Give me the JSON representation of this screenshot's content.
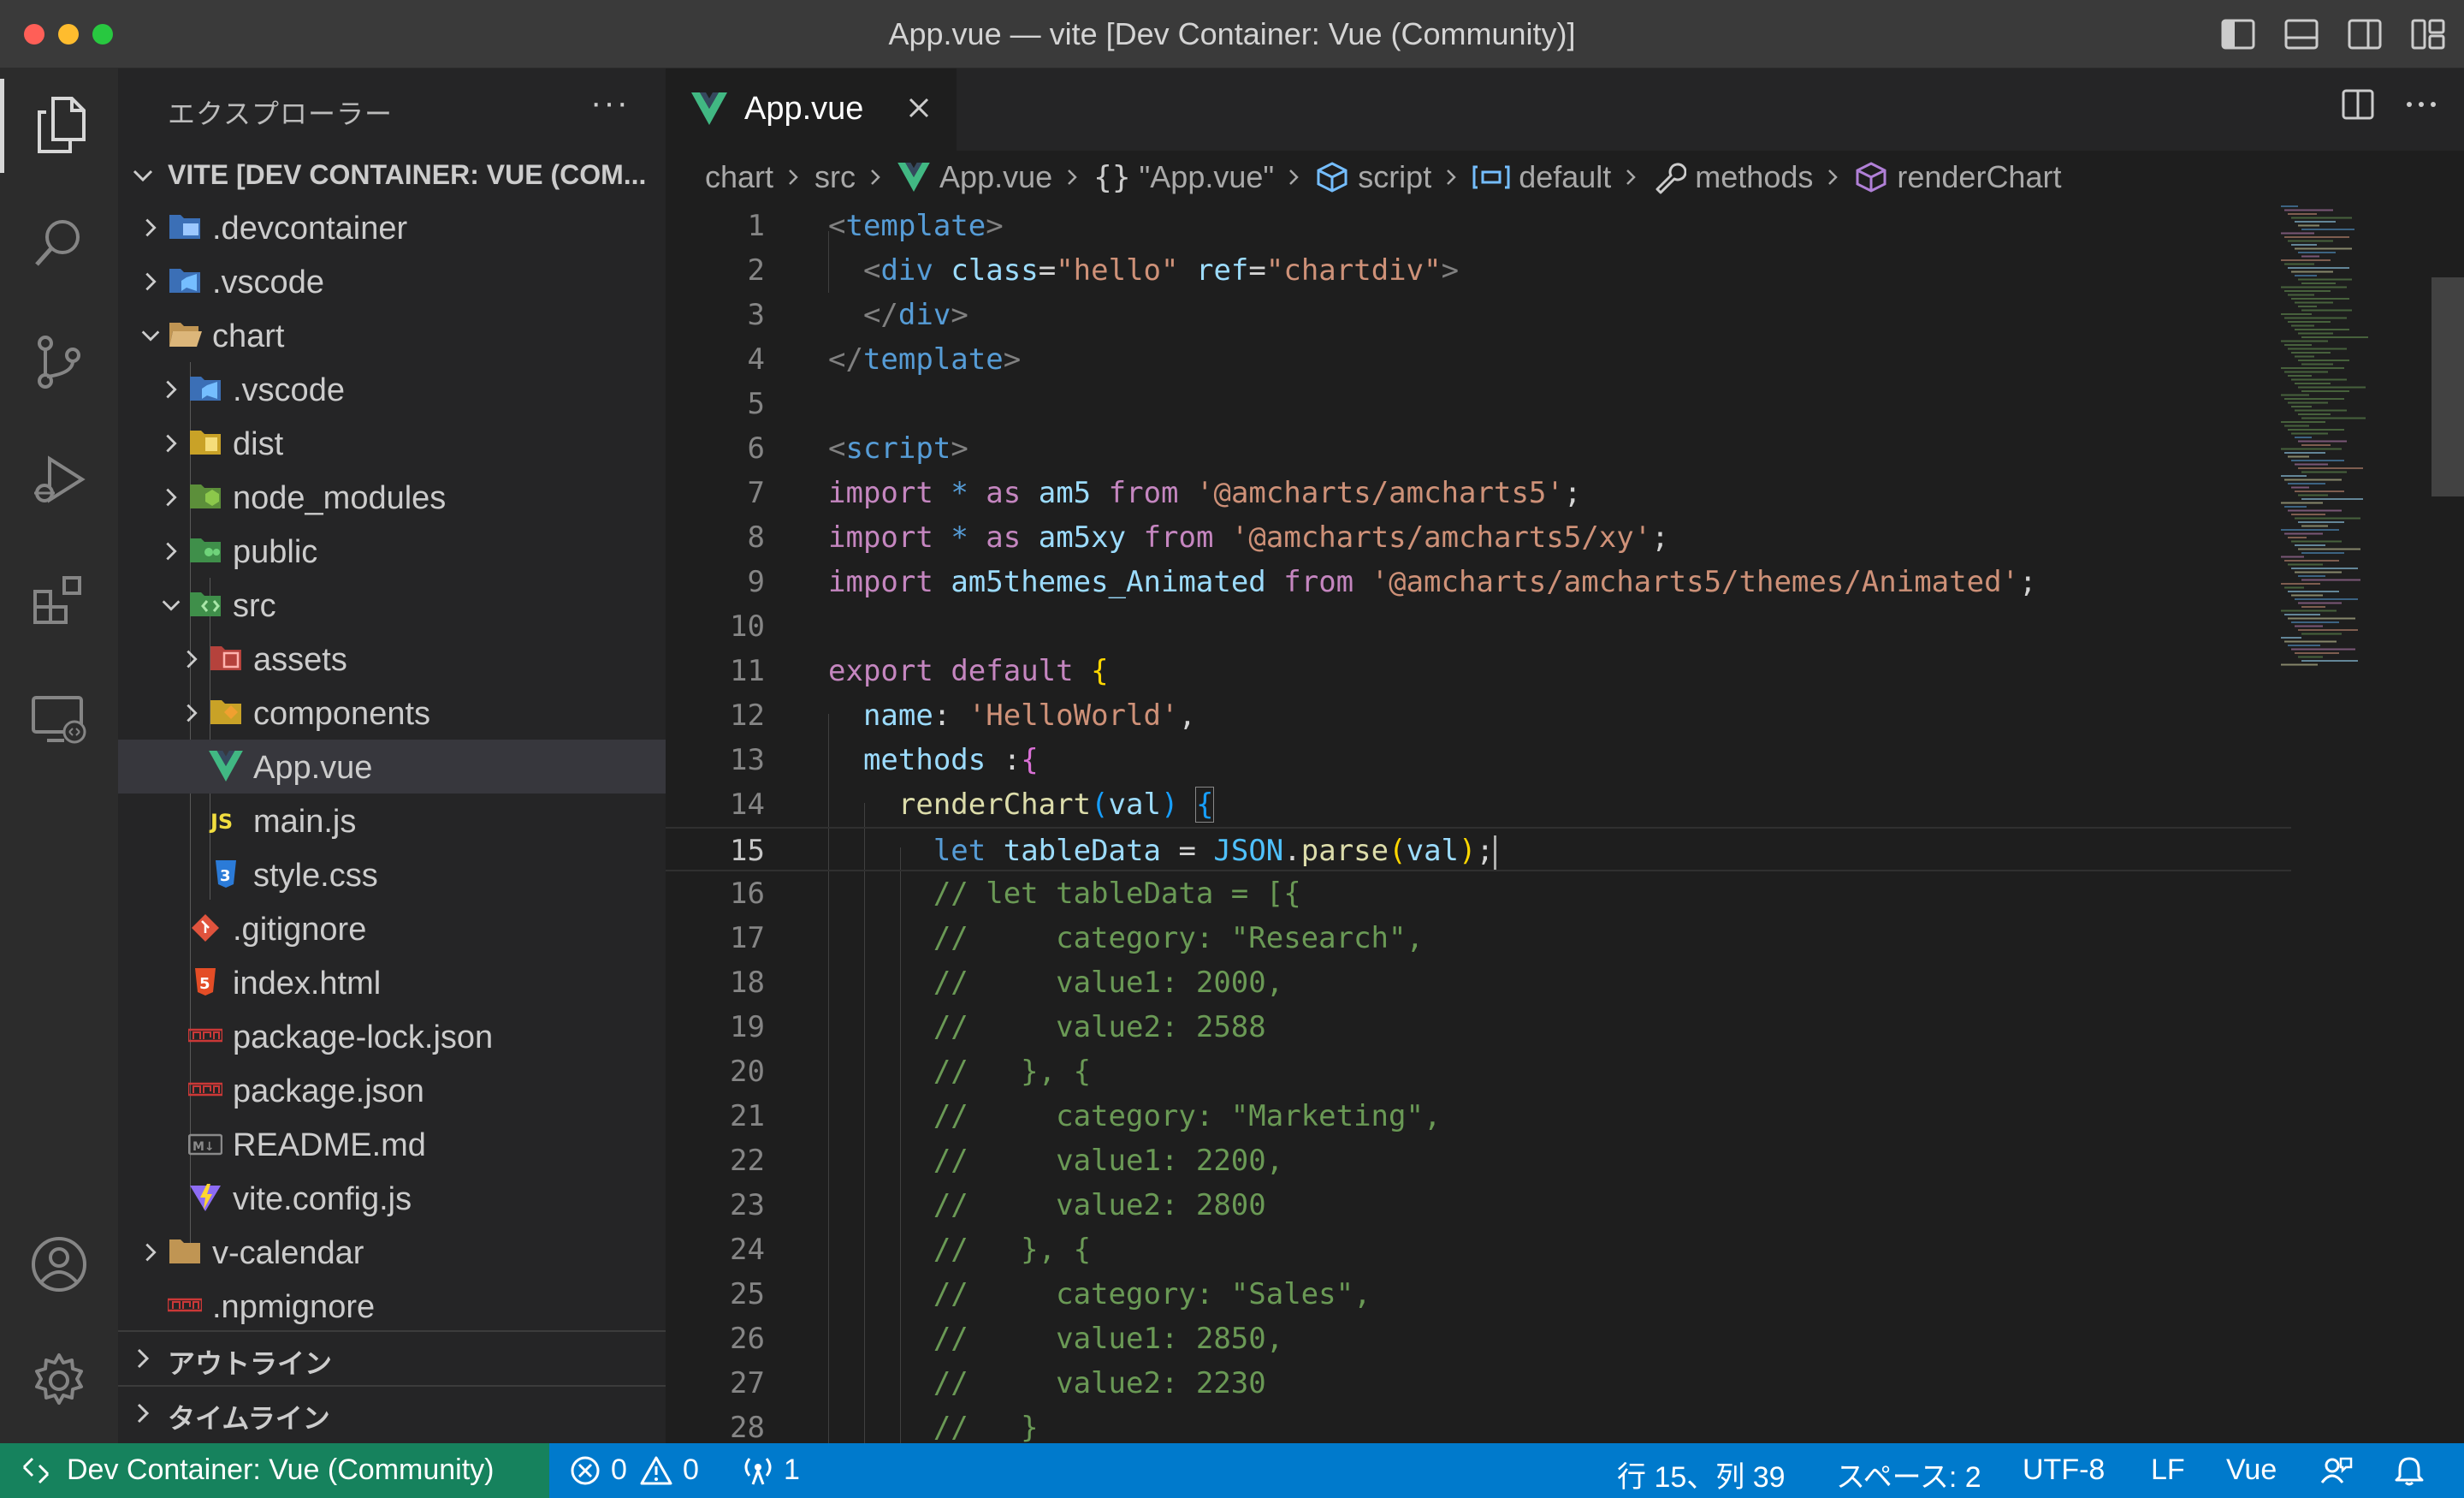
{
  "window": {
    "title": "App.vue — vite [Dev Container: Vue (Community)]"
  },
  "explorer": {
    "title": "エクスプローラー",
    "more": "···",
    "root": "VITE [DEV CONTAINER: VUE (COM...",
    "items": [
      {
        "label": ".devcontainer",
        "icon": "folder-devcontainer-icon"
      },
      {
        "label": ".vscode",
        "icon": "folder-vscode-icon"
      },
      {
        "label": "chart",
        "icon": "folder-open-icon"
      },
      {
        "label": ".vscode",
        "icon": "folder-vscode-icon"
      },
      {
        "label": "dist",
        "icon": "folder-dist-icon"
      },
      {
        "label": "node_modules",
        "icon": "folder-node-icon"
      },
      {
        "label": "public",
        "icon": "folder-public-icon"
      },
      {
        "label": "src",
        "icon": "folder-src-icon"
      },
      {
        "label": "assets",
        "icon": "folder-assets-icon"
      },
      {
        "label": "components",
        "icon": "folder-components-icon"
      },
      {
        "label": "App.vue",
        "icon": "vue-file-icon"
      },
      {
        "label": "main.js",
        "icon": "js-file-icon"
      },
      {
        "label": "style.css",
        "icon": "css-file-icon"
      },
      {
        "label": ".gitignore",
        "icon": "git-file-icon"
      },
      {
        "label": "index.html",
        "icon": "html-file-icon"
      },
      {
        "label": "package-lock.json",
        "icon": "npm-file-icon"
      },
      {
        "label": "package.json",
        "icon": "npm-file-icon"
      },
      {
        "label": "README.md",
        "icon": "markdown-file-icon"
      },
      {
        "label": "vite.config.js",
        "icon": "vite-file-icon"
      },
      {
        "label": "v-calendar",
        "icon": "folder-icon"
      },
      {
        "label": ".npmignore",
        "icon": "npm-file-icon"
      }
    ],
    "outline": "アウトライン",
    "timeline": "タイムライン"
  },
  "tab": {
    "label": "App.vue"
  },
  "breadcrumb": {
    "items": [
      "chart",
      "src",
      "App.vue",
      "\"App.vue\"",
      "script",
      "default",
      "methods",
      "renderChart"
    ]
  },
  "code": {
    "current_line": 15,
    "lines": [
      [
        [
          "tk-punc",
          "<"
        ],
        [
          "tk-tag",
          "template"
        ],
        [
          "tk-punc",
          ">"
        ]
      ],
      [
        [
          "tk-def",
          "  "
        ],
        [
          "tk-punc",
          "<"
        ],
        [
          "tk-tag",
          "div"
        ],
        [
          "tk-def",
          " "
        ],
        [
          "tk-attr",
          "class"
        ],
        [
          "tk-def",
          "="
        ],
        [
          "tk-str",
          "\"hello\""
        ],
        [
          "tk-def",
          " "
        ],
        [
          "tk-attr",
          "ref"
        ],
        [
          "tk-def",
          "="
        ],
        [
          "tk-str",
          "\"chartdiv\""
        ],
        [
          "tk-punc",
          ">"
        ]
      ],
      [
        [
          "tk-def",
          "  "
        ],
        [
          "tk-punc",
          "</"
        ],
        [
          "tk-tag",
          "div"
        ],
        [
          "tk-punc",
          ">"
        ]
      ],
      [
        [
          "tk-punc",
          "</"
        ],
        [
          "tk-tag",
          "template"
        ],
        [
          "tk-punc",
          ">"
        ]
      ],
      [],
      [
        [
          "tk-punc",
          "<"
        ],
        [
          "tk-tag",
          "script"
        ],
        [
          "tk-punc",
          ">"
        ]
      ],
      [
        [
          "tk-kw",
          "import"
        ],
        [
          "tk-def",
          " "
        ],
        [
          "tk-kwb",
          "*"
        ],
        [
          "tk-def",
          " "
        ],
        [
          "tk-kw",
          "as"
        ],
        [
          "tk-def",
          " "
        ],
        [
          "tk-var",
          "am5"
        ],
        [
          "tk-def",
          " "
        ],
        [
          "tk-kw",
          "from"
        ],
        [
          "tk-def",
          " "
        ],
        [
          "tk-str",
          "'@amcharts/amcharts5'"
        ],
        [
          "tk-def",
          ";"
        ]
      ],
      [
        [
          "tk-kw",
          "import"
        ],
        [
          "tk-def",
          " "
        ],
        [
          "tk-kwb",
          "*"
        ],
        [
          "tk-def",
          " "
        ],
        [
          "tk-kw",
          "as"
        ],
        [
          "tk-def",
          " "
        ],
        [
          "tk-var",
          "am5xy"
        ],
        [
          "tk-def",
          " "
        ],
        [
          "tk-kw",
          "from"
        ],
        [
          "tk-def",
          " "
        ],
        [
          "tk-str",
          "'@amcharts/amcharts5/xy'"
        ],
        [
          "tk-def",
          ";"
        ]
      ],
      [
        [
          "tk-kw",
          "import"
        ],
        [
          "tk-def",
          " "
        ],
        [
          "tk-var",
          "am5themes_Animated"
        ],
        [
          "tk-def",
          " "
        ],
        [
          "tk-kw",
          "from"
        ],
        [
          "tk-def",
          " "
        ],
        [
          "tk-str",
          "'@amcharts/amcharts5/themes/Animated'"
        ],
        [
          "tk-def",
          ";"
        ]
      ],
      [],
      [
        [
          "tk-kw",
          "export"
        ],
        [
          "tk-def",
          " "
        ],
        [
          "tk-kw",
          "default"
        ],
        [
          "tk-def",
          " "
        ],
        [
          "tk-br1",
          "{"
        ]
      ],
      [
        [
          "tk-def",
          "  "
        ],
        [
          "tk-var",
          "name"
        ],
        [
          "tk-def",
          ": "
        ],
        [
          "tk-str",
          "'HelloWorld'"
        ],
        [
          "tk-def",
          ","
        ]
      ],
      [
        [
          "tk-def",
          "  "
        ],
        [
          "tk-var",
          "methods"
        ],
        [
          "tk-def",
          " :"
        ],
        [
          "tk-br2",
          "{"
        ]
      ],
      [
        [
          "tk-def",
          "    "
        ],
        [
          "tk-fn",
          "renderChart"
        ],
        [
          "tk-br3",
          "("
        ],
        [
          "tk-var",
          "val"
        ],
        [
          "tk-br3",
          ")"
        ],
        [
          "tk-def",
          " "
        ],
        [
          "tk-br3 bracket-box",
          "{"
        ]
      ],
      [
        [
          "tk-def",
          "      "
        ],
        [
          "tk-kwb",
          "let"
        ],
        [
          "tk-def",
          " "
        ],
        [
          "tk-var",
          "tableData"
        ],
        [
          "tk-def",
          " = "
        ],
        [
          "tk-cls",
          "JSON"
        ],
        [
          "tk-def",
          "."
        ],
        [
          "tk-fn",
          "parse"
        ],
        [
          "tk-br1",
          "("
        ],
        [
          "tk-var",
          "val"
        ],
        [
          "tk-br1",
          ")"
        ],
        [
          "tk-def",
          ";"
        ]
      ],
      [
        [
          "tk-cmt",
          "      // let tableData = [{"
        ]
      ],
      [
        [
          "tk-cmt",
          "      //     category: \"Research\","
        ]
      ],
      [
        [
          "tk-cmt",
          "      //     value1: 2000,"
        ]
      ],
      [
        [
          "tk-cmt",
          "      //     value2: 2588"
        ]
      ],
      [
        [
          "tk-cmt",
          "      //   }, {"
        ]
      ],
      [
        [
          "tk-cmt",
          "      //     category: \"Marketing\","
        ]
      ],
      [
        [
          "tk-cmt",
          "      //     value1: 2200,"
        ]
      ],
      [
        [
          "tk-cmt",
          "      //     value2: 2800"
        ]
      ],
      [
        [
          "tk-cmt",
          "      //   }, {"
        ]
      ],
      [
        [
          "tk-cmt",
          "      //     category: \"Sales\","
        ]
      ],
      [
        [
          "tk-cmt",
          "      //     value1: 2850,"
        ]
      ],
      [
        [
          "tk-cmt",
          "      //     value2: 2230"
        ]
      ],
      [
        [
          "tk-cmt",
          "      //   }"
        ]
      ]
    ]
  },
  "status": {
    "remote": "Dev Container: Vue (Community)",
    "errors": "0",
    "warnings": "0",
    "ports": "1",
    "position": "行 15、列 39",
    "spaces": "スペース: 2",
    "encoding": "UTF-8",
    "eol": "LF",
    "language": "Vue"
  },
  "colors": {
    "accent": "#007acc",
    "remote": "#16825d",
    "vue": "#41b883"
  }
}
